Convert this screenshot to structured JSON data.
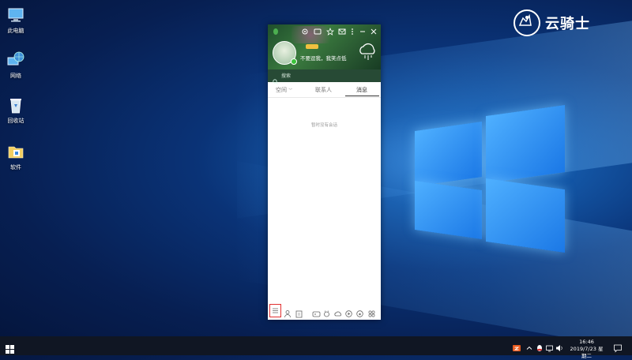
{
  "desktop": {
    "icons": [
      {
        "label": "此电脑",
        "icon": "computer-icon"
      },
      {
        "label": "网络",
        "icon": "network-icon"
      },
      {
        "label": "回收站",
        "icon": "recycle-bin-icon"
      },
      {
        "label": "软件",
        "icon": "folder-icon"
      }
    ]
  },
  "watermark": {
    "text": "云骑士"
  },
  "qq": {
    "nickname": "不要逗我，我笑点低",
    "search_placeholder": "搜索",
    "tabs": [
      {
        "label": "空间"
      },
      {
        "label": "联系人"
      },
      {
        "label": "消息"
      }
    ],
    "empty_message": "暂时没有会话",
    "colors": {
      "header": "#2a5a32",
      "highlight": "#e23030"
    }
  },
  "taskbar": {
    "time": "16:46",
    "date": "2019/7/23 星期二"
  }
}
